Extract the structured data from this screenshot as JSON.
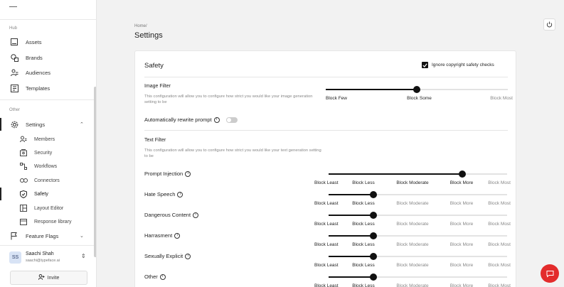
{
  "sidebar": {
    "hub_label": "Hub",
    "hub_items": [
      {
        "label": "Assets",
        "icon": "image-icon"
      },
      {
        "label": "Brands",
        "icon": "brands-icon"
      },
      {
        "label": "Audiences",
        "icon": "audience-icon"
      },
      {
        "label": "Templates",
        "icon": "template-icon"
      }
    ],
    "other_label": "Other",
    "settings_label": "Settings",
    "sub_items": [
      {
        "label": "Members",
        "icon": "members-icon"
      },
      {
        "label": "Security",
        "icon": "security-icon"
      },
      {
        "label": "Workflows",
        "icon": "workflow-icon"
      },
      {
        "label": "Connectors",
        "icon": "link-icon"
      },
      {
        "label": "Safety",
        "icon": "shield-icon"
      },
      {
        "label": "Layout Editor",
        "icon": "layout-icon"
      },
      {
        "label": "Response library",
        "icon": "library-icon"
      }
    ],
    "feature_flags_label": "Feature Flags",
    "user": {
      "initials": "SS",
      "name": "Saachi Shah",
      "email": "saachi@typeface.ai"
    },
    "invite_label": "Invite"
  },
  "main": {
    "breadcrumb": "Home/",
    "title": "Settings"
  },
  "safety": {
    "title": "Safety",
    "ignore_copyright_label": "Ignore copyright safety checks",
    "ignore_copyright_checked": true,
    "image_filter": {
      "title": "Image Filter",
      "description": "This configuration will allow you to configure how strict you would like your image generation setting to be",
      "options": [
        "Block Few",
        "Block Some",
        "Block Most"
      ],
      "selected": "Block Some"
    },
    "auto_rewrite_label": "Automatically rewrite prompt",
    "auto_rewrite_on": false,
    "text_filter": {
      "title": "Text Filter",
      "description": "This configuration will allow you to configure how strict you would like your text generation setting to be",
      "options": [
        "Block Least",
        "Block Less",
        "Block Moderate",
        "Block More",
        "Block Most"
      ],
      "rows": [
        {
          "label": "Prompt Injection",
          "selected": "Block More"
        },
        {
          "label": "Hate Speech",
          "selected": "Block Less"
        },
        {
          "label": "Dangerous Content",
          "selected": "Block Less"
        },
        {
          "label": "Harrasment",
          "selected": "Block Less"
        },
        {
          "label": "Sexually Explicit",
          "selected": "Block Less"
        },
        {
          "label": "Other",
          "selected": "Block Less"
        }
      ]
    }
  },
  "colors": {
    "accent": "#111111",
    "chat_button": "#e32c2c"
  }
}
